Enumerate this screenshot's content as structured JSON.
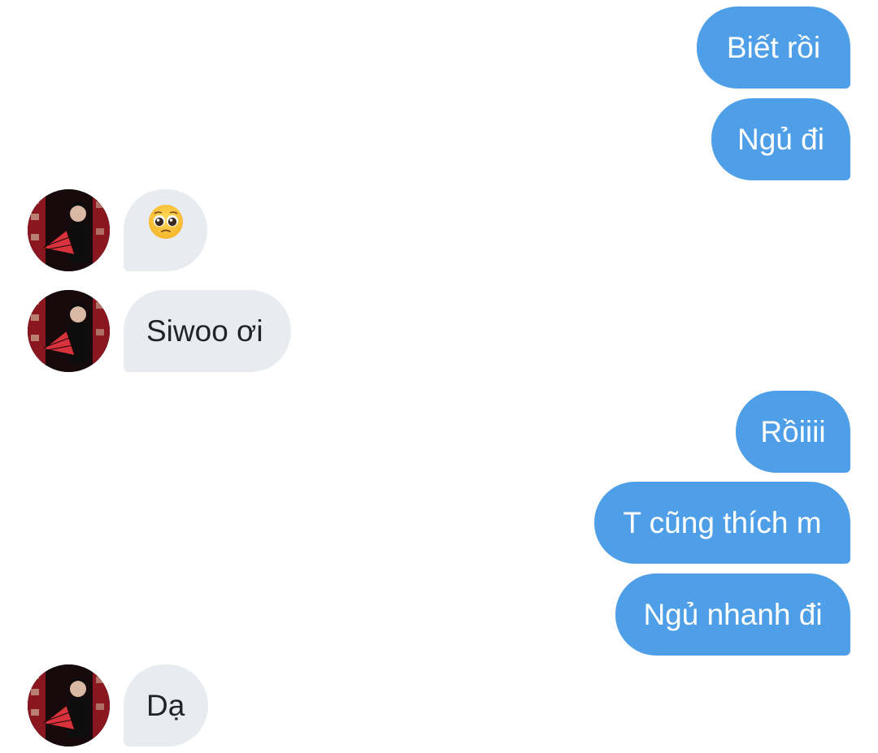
{
  "messages": [
    {
      "side": "out",
      "text": "Biết rồi"
    },
    {
      "side": "out",
      "text": "Ngủ đi"
    },
    {
      "side": "in",
      "icon": "pleading-face-icon"
    },
    {
      "side": "in",
      "text": "Siwoo ơi"
    },
    {
      "side": "out",
      "text": "Rồiiii"
    },
    {
      "side": "out",
      "text": "T cũng thích m"
    },
    {
      "side": "out",
      "text": "Ngủ nhanh đi"
    },
    {
      "side": "in",
      "text": "Dạ"
    }
  ],
  "colors": {
    "outgoing_bubble": "#4f9fe8",
    "incoming_bubble": "#e8ecf1",
    "outgoing_text": "#ffffff",
    "incoming_text": "#1f2429"
  },
  "avatar": {
    "icon": "contact-avatar"
  }
}
